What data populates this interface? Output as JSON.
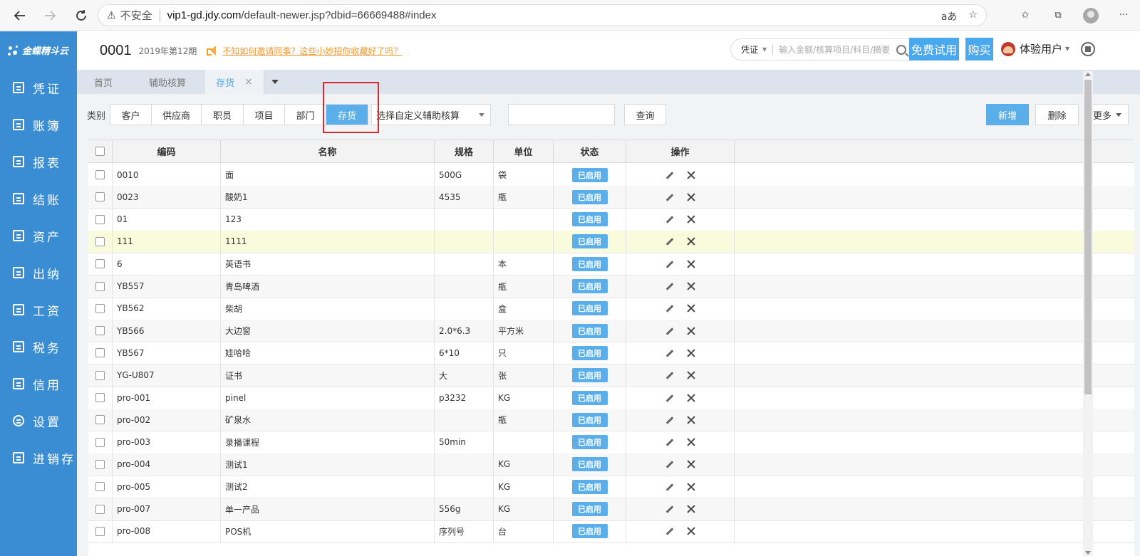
{
  "browser": {
    "insecure_label": "不安全",
    "url_host": "vip1-gd.jdy.com",
    "url_path": "/default-newer.jsp?dbid=66669488#index",
    "read_aloud": "aあ"
  },
  "sidebar": {
    "logo": "金蝶精斗云",
    "items": [
      {
        "label": "凭证"
      },
      {
        "label": "账簿"
      },
      {
        "label": "报表"
      },
      {
        "label": "结账"
      },
      {
        "label": "资产"
      },
      {
        "label": "出纳"
      },
      {
        "label": "工资"
      },
      {
        "label": "税务"
      },
      {
        "label": "信用"
      },
      {
        "label": "设置"
      },
      {
        "label": "进销存"
      }
    ]
  },
  "header": {
    "company": "0001",
    "period": "2019年第12期",
    "notice": "不知如何邀请同事？这些小妙招你收藏好了吗？",
    "search_type": "凭证",
    "search_placeholder": "输入金额/核算项目/科目/摘要",
    "trial_label": "免费试用",
    "buy_label": "购买",
    "user_name": "体验用户"
  },
  "tabs": [
    {
      "label": "首页"
    },
    {
      "label": "辅助核算"
    },
    {
      "label": "存货"
    }
  ],
  "filters": {
    "category_label": "类别",
    "categories": [
      "客户",
      "供应商",
      "职员",
      "项目",
      "部门",
      "存货"
    ],
    "active_category": "存货",
    "aux_select": "选择自定义辅助核算",
    "query_label": "查询",
    "new_label": "新增",
    "delete_label": "删除",
    "more_label": "更多"
  },
  "table": {
    "headers": [
      "编码",
      "名称",
      "规格",
      "单位",
      "状态",
      "操作"
    ],
    "status_label": "已启用",
    "rows": [
      {
        "code": "0010",
        "name": "面",
        "spec": "500G",
        "unit": "袋"
      },
      {
        "code": "0023",
        "name": "酸奶1",
        "spec": "4535",
        "unit": "瓶"
      },
      {
        "code": "01",
        "name": "123",
        "spec": "",
        "unit": ""
      },
      {
        "code": "111",
        "name": "1111",
        "spec": "",
        "unit": ""
      },
      {
        "code": "6",
        "name": "英语书",
        "spec": "",
        "unit": "本"
      },
      {
        "code": "YB557",
        "name": "青岛啤酒",
        "spec": "",
        "unit": "瓶"
      },
      {
        "code": "YB562",
        "name": "柴胡",
        "spec": "",
        "unit": "盒"
      },
      {
        "code": "YB566",
        "name": "大边窗",
        "spec": "2.0*6.3",
        "unit": "平方米"
      },
      {
        "code": "YB567",
        "name": "娃哈哈",
        "spec": "6*10",
        "unit": "只"
      },
      {
        "code": "YG-U807",
        "name": "证书",
        "spec": "大",
        "unit": "张"
      },
      {
        "code": "pro-001",
        "name": "pinel",
        "spec": "p3232",
        "unit": "KG"
      },
      {
        "code": "pro-002",
        "name": "矿泉水",
        "spec": "",
        "unit": "瓶"
      },
      {
        "code": "pro-003",
        "name": "录播课程",
        "spec": "50min",
        "unit": ""
      },
      {
        "code": "pro-004",
        "name": "测试1",
        "spec": "",
        "unit": "KG"
      },
      {
        "code": "pro-005",
        "name": "测试2",
        "spec": "",
        "unit": "KG"
      },
      {
        "code": "pro-007",
        "name": "单一产品",
        "spec": "556g",
        "unit": "KG"
      },
      {
        "code": "pro-008",
        "name": "POS机",
        "spec": "序列号",
        "unit": "台"
      }
    ]
  }
}
